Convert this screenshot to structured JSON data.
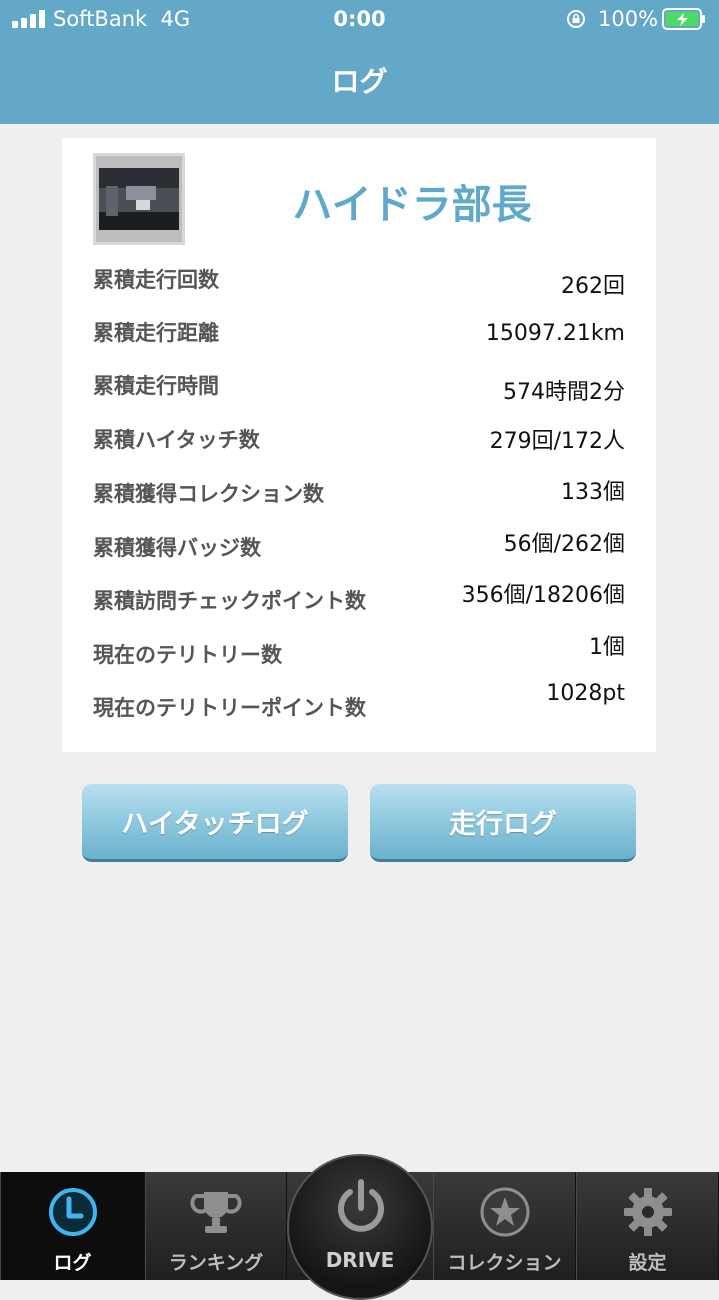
{
  "status_bar": {
    "carrier": "SoftBank",
    "network": "4G",
    "time": "0:00",
    "battery_percent": "100%",
    "battery_level": 1.0,
    "icons": [
      "signal-icon",
      "rotation-lock-icon",
      "battery-charging-icon"
    ]
  },
  "header": {
    "title": "ログ",
    "background_color": "#64a8c8"
  },
  "profile": {
    "name": "ハイドラ部長",
    "name_color": "#5ea9c9",
    "stats": [
      {
        "label": "累積走行回数",
        "value": "262回"
      },
      {
        "label": "累積走行距離",
        "value": "15097.21km"
      },
      {
        "label": "累積走行時間",
        "value": "574時間2分"
      },
      {
        "label": "累積ハイタッチ数",
        "value": "279回/172人"
      },
      {
        "label": "累積獲得コレクション数",
        "value": "133個"
      },
      {
        "label": "累積獲得バッジ数",
        "value": "56個/262個"
      },
      {
        "label": "累積訪問チェックポイント数",
        "value": "356個/18206個"
      },
      {
        "label": "現在のテリトリー数",
        "value": "1個"
      },
      {
        "label": "現在のテリトリーポイント数",
        "value": "1028pt"
      }
    ]
  },
  "buttons": {
    "hitouch_log": "ハイタッチログ",
    "drive_log": "走行ログ"
  },
  "tabbar": {
    "tabs": [
      {
        "label": "ログ",
        "icon": "clock-icon",
        "active": true
      },
      {
        "label": "ランキング",
        "icon": "trophy-icon",
        "active": false
      },
      {
        "label": "DRIVE",
        "icon": "power-icon",
        "active": false
      },
      {
        "label": "コレクション",
        "icon": "star-icon",
        "active": false
      },
      {
        "label": "設定",
        "icon": "gear-icon",
        "active": false
      }
    ]
  }
}
